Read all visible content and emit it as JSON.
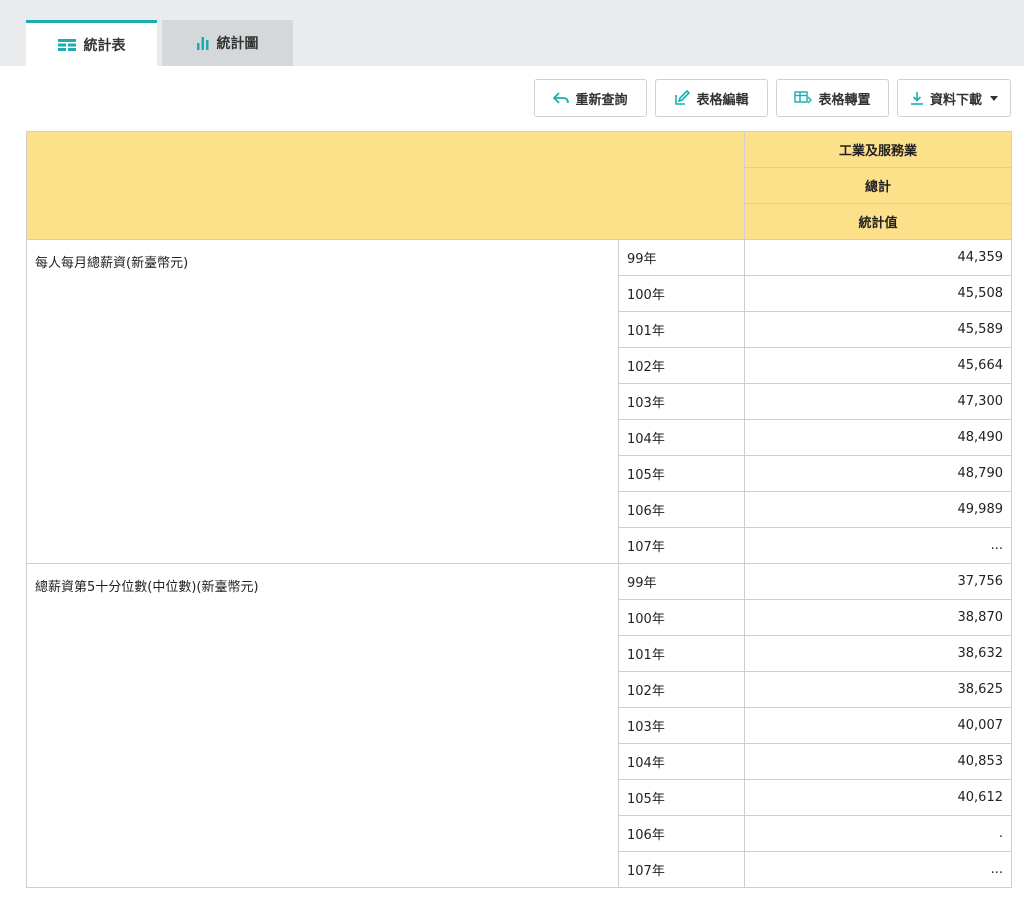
{
  "tabs": [
    {
      "label": "統計表",
      "icon": "table-icon"
    },
    {
      "label": "統計圖",
      "icon": "bar-chart-icon"
    }
  ],
  "toolbar": {
    "requery": "重新查詢",
    "edit": "表格編輯",
    "transpose": "表格轉置",
    "download": "資料下載"
  },
  "colors": {
    "accent": "#1aaeb0",
    "header_bg": "#fde18a"
  },
  "table": {
    "headers": [
      "工業及服務業",
      "總計",
      "統計值"
    ],
    "groups": [
      {
        "label": "每人每月總薪資(新臺幣元)",
        "rows": [
          {
            "year": "99年",
            "value": "44,359"
          },
          {
            "year": "100年",
            "value": "45,508"
          },
          {
            "year": "101年",
            "value": "45,589"
          },
          {
            "year": "102年",
            "value": "45,664"
          },
          {
            "year": "103年",
            "value": "47,300"
          },
          {
            "year": "104年",
            "value": "48,490"
          },
          {
            "year": "105年",
            "value": "48,790"
          },
          {
            "year": "106年",
            "value": "49,989"
          },
          {
            "year": "107年",
            "value": "..."
          }
        ]
      },
      {
        "label": "總薪資第5十分位數(中位數)(新臺幣元)",
        "rows": [
          {
            "year": "99年",
            "value": "37,756"
          },
          {
            "year": "100年",
            "value": "38,870"
          },
          {
            "year": "101年",
            "value": "38,632"
          },
          {
            "year": "102年",
            "value": "38,625"
          },
          {
            "year": "103年",
            "value": "40,007"
          },
          {
            "year": "104年",
            "value": "40,853"
          },
          {
            "year": "105年",
            "value": "40,612"
          },
          {
            "year": "106年",
            "value": "."
          },
          {
            "year": "107年",
            "value": "..."
          }
        ]
      }
    ]
  }
}
